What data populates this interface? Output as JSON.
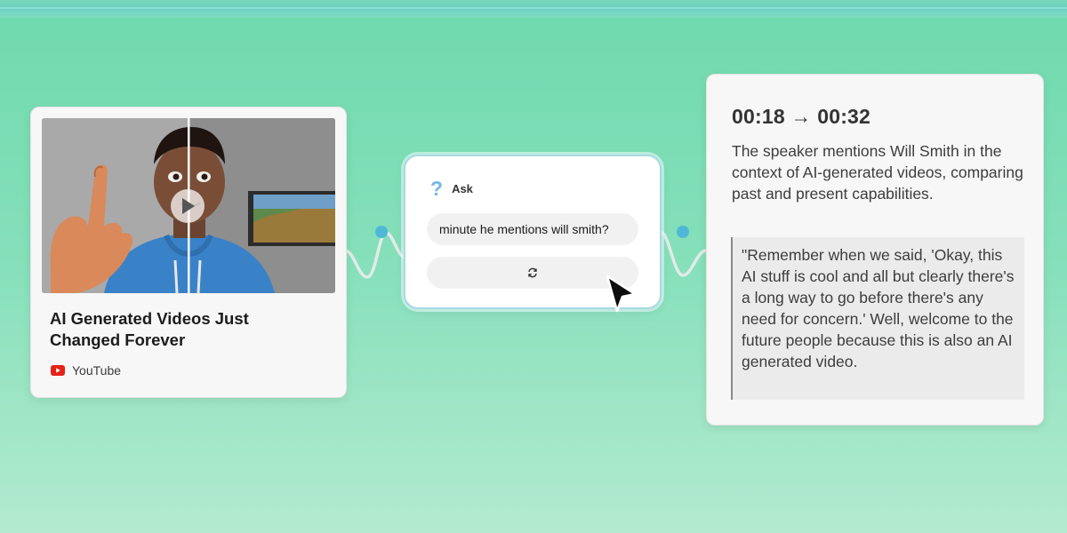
{
  "video_card": {
    "title": "AI Generated Videos Just Changed Forever",
    "source": "YouTube",
    "source_icon": "youtube-icon",
    "thumbnail_icon": "play-icon"
  },
  "ask_card": {
    "label": "Ask",
    "icon": "question-icon",
    "query": "minute he mentions will smith?",
    "action_icon": "refresh-icon"
  },
  "result_card": {
    "timestamp": "00:18 → 00:32",
    "summary": "The speaker mentions Will Smith in the context of AI-generated videos, comparing past and present capabilities.",
    "quote": "\"Remember when we said, 'Okay, this AI stuff is cool and all but clearly there's a long way to go before there's any need for concern.' Well, welcome to the future people because this is also an AI generated video."
  },
  "colors": {
    "background_top": "#6fd9ad",
    "background_bottom": "#b3ead0",
    "connector_dot": "#4fb8d8",
    "ask_border": "#a9d9e3",
    "youtube_red": "#e62117"
  }
}
